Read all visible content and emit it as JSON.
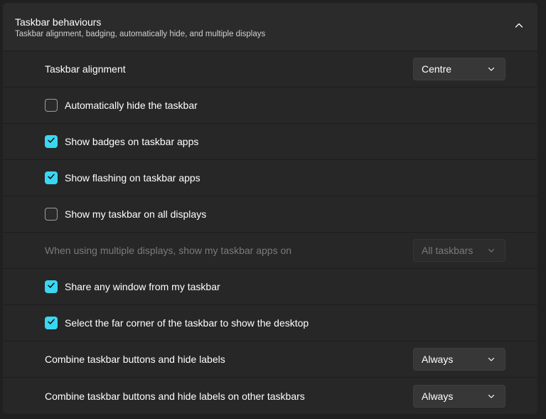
{
  "header": {
    "title": "Taskbar behaviours",
    "subtitle": "Taskbar alignment, badging, automatically hide, and multiple displays",
    "collapse_icon": "chevron-up-icon"
  },
  "colors": {
    "accent": "#3ad7f1",
    "background": "#202020",
    "card": "#272727",
    "disabled_text": "#7a7a7a"
  },
  "settings": {
    "alignment": {
      "label": "Taskbar alignment",
      "value": "Centre"
    },
    "auto_hide": {
      "label": "Automatically hide the taskbar",
      "checked": false
    },
    "badges": {
      "label": "Show badges on taskbar apps",
      "checked": true
    },
    "flashing": {
      "label": "Show flashing on taskbar apps",
      "checked": true
    },
    "all_displays": {
      "label": "Show my taskbar on all displays",
      "checked": false
    },
    "multi_display_apps": {
      "label": "When using multiple displays, show my taskbar apps on",
      "value": "All taskbars",
      "disabled": true
    },
    "share_window": {
      "label": "Share any window from my taskbar",
      "checked": true
    },
    "far_corner": {
      "label": "Select the far corner of the taskbar to show the desktop",
      "checked": true
    },
    "combine_buttons": {
      "label": "Combine taskbar buttons and hide labels",
      "value": "Always"
    },
    "combine_other": {
      "label": "Combine taskbar buttons and hide labels on other taskbars",
      "value": "Always"
    }
  }
}
